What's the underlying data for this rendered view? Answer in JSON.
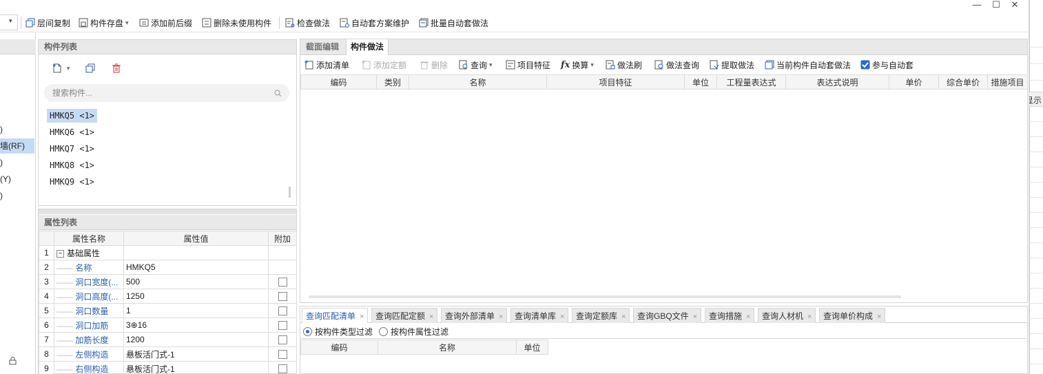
{
  "window": {
    "minimize": "—",
    "maximize": "☐",
    "close": "✕"
  },
  "toolbar": {
    "combo_arrow": "▾",
    "items": [
      {
        "label": "层间复制",
        "icon": "copy-floors-icon"
      },
      {
        "label": "构件存盘",
        "icon": "save-component-icon",
        "arrow": "▾"
      },
      {
        "label": "添加前后缀",
        "icon": "add-affix-icon"
      },
      {
        "label": "删除未使用构件",
        "icon": "delete-unused-icon"
      },
      {
        "label": "检查做法",
        "icon": "check-method-icon"
      },
      {
        "label": "自动套方案维护",
        "icon": "auto-scheme-icon"
      },
      {
        "label": "批量自动套做法",
        "icon": "batch-auto-icon"
      }
    ]
  },
  "left_strip": {
    "items": [
      ")",
      "墙(RF)",
      ")",
      "(Y)",
      ")"
    ]
  },
  "component_list": {
    "title": "构件列表",
    "search_placeholder": "搜索构件...",
    "items": [
      "HMKQ5 <1>",
      "HMKQ6 <1>",
      "HMKQ7 <1>",
      "HMKQ8 <1>",
      "HMKQ9 <1>"
    ],
    "selected_index": 0
  },
  "property_list": {
    "title": "属性列表",
    "headers": [
      "属性名称",
      "属性值",
      "附加"
    ],
    "rows": [
      {
        "n": "1",
        "name": "基础属性",
        "value": "",
        "group": true
      },
      {
        "n": "2",
        "name": "名称",
        "value": "HMKQ5"
      },
      {
        "n": "3",
        "name": "洞口宽度(...",
        "value": "500",
        "check": true
      },
      {
        "n": "4",
        "name": "洞口高度(...",
        "value": "1250",
        "check": true
      },
      {
        "n": "5",
        "name": "洞口数量",
        "value": "1",
        "check": true
      },
      {
        "n": "6",
        "name": "洞口加筋",
        "value": "3⊕16",
        "check": true
      },
      {
        "n": "7",
        "name": "加筋长度",
        "value": "1200",
        "check": true
      },
      {
        "n": "8",
        "name": "左侧构造",
        "value": "悬板活门式-1",
        "check": true
      },
      {
        "n": "9",
        "name": "右侧构造",
        "value": "悬板活门式-1",
        "check": true
      }
    ]
  },
  "right_panel": {
    "tabs": [
      "截面编辑",
      "构件做法"
    ],
    "active_tab": 1,
    "toolbar": [
      {
        "label": "添加清单",
        "icon": "add-list-icon",
        "disabled": false
      },
      {
        "label": "添加定额",
        "icon": "add-quota-icon",
        "disabled": true
      },
      {
        "label": "删除",
        "icon": "delete-icon",
        "disabled": true
      },
      {
        "label": "查询",
        "icon": "query-icon",
        "disabled": false,
        "arrow": "▾"
      },
      {
        "label": "项目特征",
        "icon": "project-feature-icon",
        "disabled": false
      },
      {
        "label": "换算",
        "icon": "fx-icon",
        "disabled": false,
        "arrow": "▾"
      },
      {
        "label": "做法刷",
        "icon": "method-brush-icon",
        "disabled": false
      },
      {
        "label": "做法查询",
        "icon": "method-query-icon",
        "disabled": false
      },
      {
        "label": "提取做法",
        "icon": "extract-method-icon",
        "disabled": false
      },
      {
        "label": "当前构件自动套做法",
        "icon": "auto-apply-icon",
        "disabled": false
      },
      {
        "label": "参与自动套",
        "icon": "checkbox-icon",
        "disabled": false,
        "checked": true
      }
    ],
    "fx_glyph": "fx",
    "table_headers": [
      "编码",
      "类别",
      "名称",
      "项目特征",
      "单位",
      "工程量表达式",
      "表达式说明",
      "单价",
      "综合单价",
      "措施项目"
    ]
  },
  "bottom_panel": {
    "tabs": [
      "查询匹配清单",
      "查询匹配定额",
      "查询外部清单",
      "查询清单库",
      "查询定额库",
      "查询GBQ文件",
      "查询措施",
      "查询人材机",
      "查询单价构成"
    ],
    "close_glyph": "×",
    "active_tab": 0,
    "filters": [
      {
        "label": "按构件类型过滤",
        "checked": true
      },
      {
        "label": "按构件属性过滤",
        "checked": false
      }
    ],
    "table_headers": [
      "编码",
      "名称",
      "单位"
    ]
  },
  "far_right": {
    "label": "显示"
  },
  "colors": {
    "accent": "#2a5db0",
    "selection": "#c5dbf5",
    "panel_header": "#e9e9e9"
  }
}
